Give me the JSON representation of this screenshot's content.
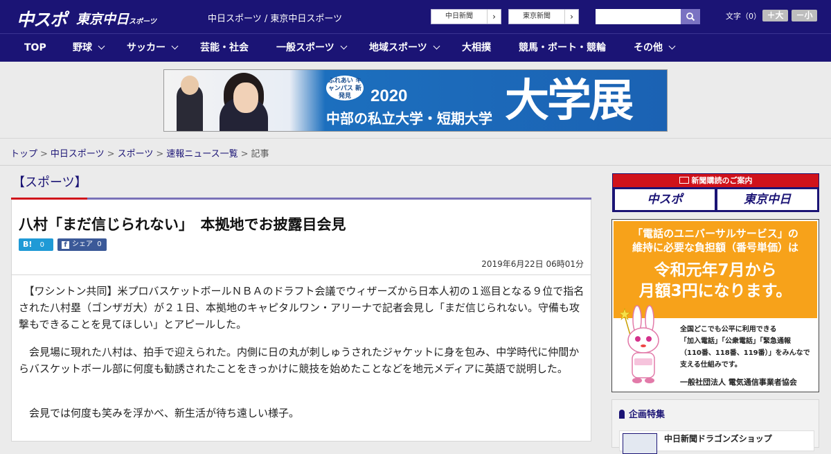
{
  "header": {
    "logo_chuspo": "中スポ",
    "logo_tokyo": "東京中日",
    "logo_tokyo_small": "スポーツ",
    "site_name": "中日スポーツ / 東京中日スポーツ",
    "btn_chunichi": "中日新聞",
    "btn_tokyo": "東京新聞",
    "arrow": "›",
    "search_placeholder": "",
    "font_label": "文字（0）",
    "font_bigger": "＋大",
    "font_smaller": "－小"
  },
  "nav": {
    "items": [
      "TOP",
      "野球",
      "サッカー",
      "芸能・社会",
      "一般スポーツ",
      "地域スポーツ",
      "大相撲",
      "競馬・ボート・競輪",
      "その他"
    ]
  },
  "banner": {
    "badge": "ふれあい キャンパス 新発見",
    "year": "2020",
    "subtitle": "中部の私立大学・短期大学",
    "big": "大学展"
  },
  "breadcrumb": {
    "items": [
      "トップ",
      "中日スポーツ",
      "スポーツ",
      "速報ニュース一覧",
      "記事"
    ],
    "separator": ">"
  },
  "article": {
    "category": "【スポーツ】",
    "title": "八村「まだ信じられない」　本拠地でお披露目会見",
    "hatena_label": "B!",
    "hatena_count": "0",
    "fb_label": "シェア",
    "fb_count": "0",
    "date": "2019年6月22日 06時01分",
    "paragraphs": [
      "　【ワシントン共同】米プロバスケットボールＮＢＡのドラフト会議でウィザーズから日本人初の１巡目となる９位で指名された八村塁（ゴンザガ大）が２１日、本拠地のキャピタルワン・アリーナで記者会見し「まだ信じられない。守備も攻撃もできることを見てほしい」とアピールした。",
      "　会見場に現れた八村は、拍手で迎えられた。内側に日の丸が刺しゅうされたジャケットに身を包み、中学時代に仲間からバスケットボール部に何度も勧誘されたことをきっかけに競技を始めたことなどを地元メディアに英語で説明した。",
      "　会見では何度も笑みを浮かべ、新生活が待ち遠しい様子。"
    ]
  },
  "sidebar": {
    "subscribe_title": "新聞購読のご案内",
    "subscribe_chuspo": "中スポ",
    "subscribe_tokyo": "東京中日",
    "ad_line1": "「電話のユニバーサルサービス」の",
    "ad_line2": "維持に必要な負担額（番号単価）は",
    "ad_big1": "令和元年7月から",
    "ad_big2": "月額3円になります。",
    "ad_body1": "全国どこでも公平に利用できる",
    "ad_body2": "「加入電話」「公衆電話」「緊急通報",
    "ad_body3": "（110番、118番、119番）」をみんなで",
    "ad_body4": "支える仕組みです。",
    "ad_org": "一般社団法人 電気通信事業者協会",
    "feature_title": "企画特集",
    "feature_item": "中日新聞ドラゴンズショップ"
  },
  "colors": {
    "navy": "#1b1475",
    "accent_red": "#d0121b",
    "purple_rule": "#7a72b8",
    "ad_orange": "#f7a21a"
  }
}
